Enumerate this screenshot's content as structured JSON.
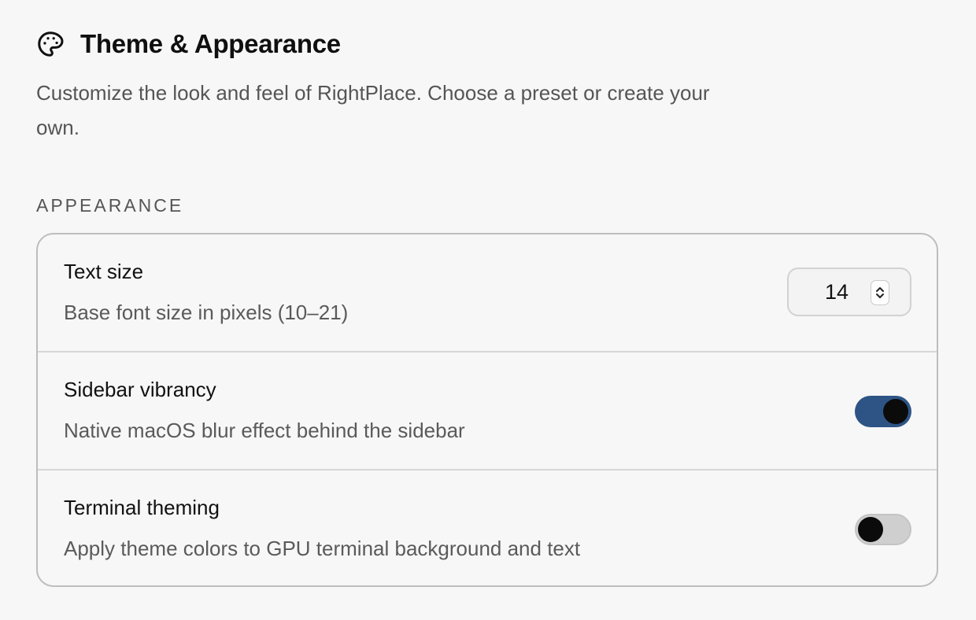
{
  "header": {
    "icon": "palette-icon",
    "title": "Theme & Appearance",
    "description": "Customize the look and feel of RightPlace. Choose a preset or create your own."
  },
  "section": {
    "label": "APPEARANCE"
  },
  "settings": {
    "text_size": {
      "label": "Text size",
      "description": "Base font size in pixels (10–21)",
      "value": "14"
    },
    "sidebar_vibrancy": {
      "label": "Sidebar vibrancy",
      "description": "Native macOS blur effect behind the sidebar",
      "enabled": true
    },
    "terminal_theming": {
      "label": "Terminal theming",
      "description": "Apply theme colors to GPU terminal background and text",
      "enabled": false
    }
  },
  "colors": {
    "accent": "#2e5486",
    "toggle_off": "#cfcfcf",
    "background": "#f7f7f7"
  }
}
